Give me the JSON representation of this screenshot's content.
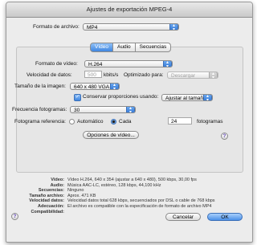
{
  "window": {
    "title": "Ajustes de exportación MPEG-4"
  },
  "format": {
    "label": "Formato de archivo:",
    "value": "MP4"
  },
  "tabs": [
    {
      "label": "Vídeo",
      "active": true
    },
    {
      "label": "Audio",
      "active": false
    },
    {
      "label": "Secuencias",
      "active": false
    }
  ],
  "video": {
    "format_label": "Formato de vídeo:",
    "format_value": "H.264",
    "datarate_label": "Velocidad de datos:",
    "datarate_value": "500",
    "datarate_unit": "kbits/s",
    "optimized_label": "Optimizado para:",
    "optimized_value": "Descargar",
    "size_label": "Tamaño de la imagen:",
    "size_value": "640 x 480 VGA",
    "preserve_label": "Conservar proporciones usando:",
    "preserve_checked": true,
    "preserve_value": "Ajustar al tamaño",
    "framerate_label": "Frecuencia fotogramas:",
    "framerate_value": "30",
    "keyframe_label": "Fotograma referencia:",
    "keyframe_auto": "Automático",
    "keyframe_every": "Cada",
    "keyframe_count": "24",
    "keyframe_unit": "fotogramas",
    "options_button": "Opciones de vídeo..."
  },
  "summary": [
    {
      "key": "Vídeo:",
      "value": "Vídeo H.264, 640 x 354 (ajustar a 640 x 480), 500 kbps, 30,00 fps"
    },
    {
      "key": "Audio:",
      "value": "Música AAC-LC, estéreo, 128 kbps, 44,100 kHz"
    },
    {
      "key": "Secuencias:",
      "value": "Ninguno"
    },
    {
      "key": "Tamaño archivo:",
      "value": "Aprox. 471 KB"
    },
    {
      "key": "Velocidad datos:",
      "value": "Velocidad datos total 628 kbps, secuenciados por DSL o cable de 768 kbps"
    },
    {
      "key": "Adecuación:",
      "value": "El archivo es compatible con la especificación de formato de archivo MP4"
    },
    {
      "key": "Compatibilidad:",
      "value": ""
    }
  ],
  "buttons": {
    "cancel": "Cancelar",
    "ok": "OK",
    "help": "?"
  },
  "icons": {
    "popup_arrows": "updown-arrows-icon",
    "help": "question-mark-icon"
  },
  "colors": {
    "accent": "#3f86e0",
    "window_bg": "#ececec"
  }
}
